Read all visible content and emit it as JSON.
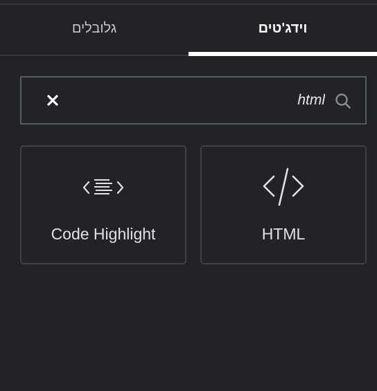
{
  "tabs": [
    {
      "label": "וידג'טים",
      "active": true
    },
    {
      "label": "גלובלים",
      "active": false
    }
  ],
  "search": {
    "value": "html",
    "placeholder": "",
    "icon": "search-icon",
    "clear_icon": "close-icon"
  },
  "widgets": [
    {
      "title": "HTML",
      "icon": "code-icon"
    },
    {
      "title": "Code Highlight",
      "icon": "code-highlight-icon"
    }
  ],
  "colors": {
    "background": "#222327",
    "active_tab_indicator": "#ffffff",
    "card_border": "#3e4046",
    "search_border": "#56595f"
  }
}
